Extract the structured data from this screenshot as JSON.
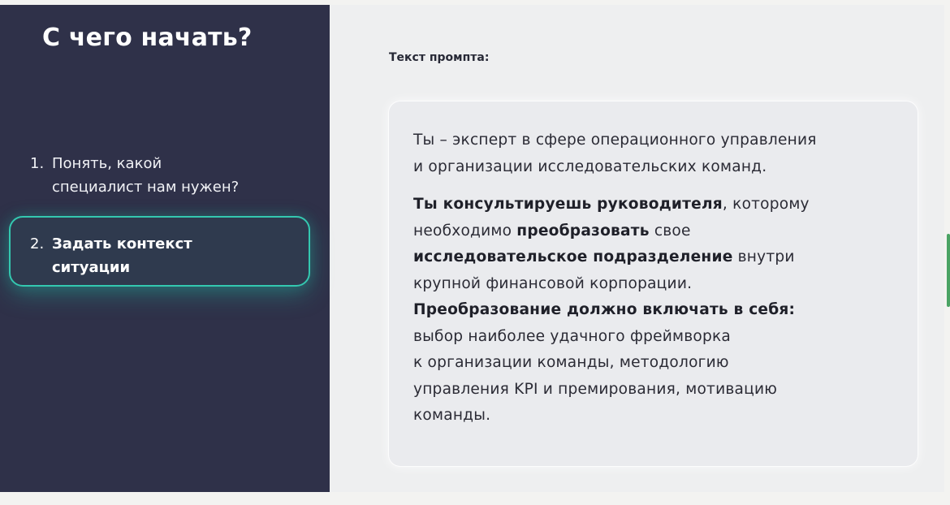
{
  "left_panel": {
    "title": "С чего начать?",
    "steps": [
      {
        "number": "1.",
        "lines": [
          "Понять, какой",
          "специалист нам нужен?"
        ]
      },
      {
        "number": "2.",
        "lines": [
          "Задать контекст",
          "ситуации"
        ],
        "active": true
      }
    ]
  },
  "main": {
    "prompt_label": "Текст промпта:",
    "prompt": {
      "para1_lines": [
        "Ты – эксперт в сфере операционного управления",
        "и организации исследовательских команд."
      ],
      "line_a_bold": "Ты консультируешь руководителя",
      "line_a_rest": ", которому",
      "line_b_pre": "необходимо ",
      "line_b_bold": "преобразовать",
      "line_b_rest": " свое",
      "line_c_bold": "исследовательское подразделение",
      "line_c_rest": " внутри",
      "line_d": "крупной финансовой корпорации.",
      "line_e_bold": "Преобразование должно включать в себя:",
      "line_f": "выбор наиболее удачного фреймворка",
      "line_g": "к организации команды, методологию",
      "line_h": "управления KPI и премирования, мотивацию",
      "line_i": "команды."
    }
  },
  "colors": {
    "sidebar_bg": "#2f3149",
    "accent": "#34c8b0",
    "content_bg": "#eeeff0",
    "text": "#2b2b35"
  }
}
